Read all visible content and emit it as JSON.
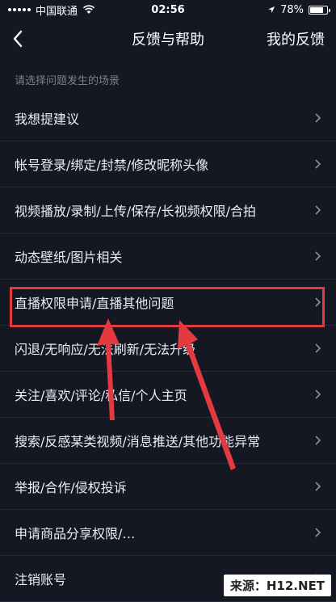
{
  "status_bar": {
    "carrier": "中国联通",
    "time": "02:56",
    "battery": "78%"
  },
  "nav": {
    "title": "反馈与帮助",
    "action": "我的反馈"
  },
  "section_hint": "请选择问题发生的场景",
  "items": [
    {
      "label": "我想提建议"
    },
    {
      "label": "帐号登录/绑定/封禁/修改昵称头像"
    },
    {
      "label": "视频播放/录制/上传/保存/长视频权限/合拍"
    },
    {
      "label": "动态壁纸/图片相关"
    },
    {
      "label": "直播权限申请/直播其他问题"
    },
    {
      "label": "闪退/无响应/无法刷新/无法升级"
    },
    {
      "label": "关注/喜欢/评论/私信/个人主页"
    },
    {
      "label": "搜索/反感某类视频/消息推送/其他功能异常"
    },
    {
      "label": "举报/合作/侵权投诉"
    },
    {
      "label": "申请商品分享权限/…"
    },
    {
      "label": "注销账号"
    }
  ],
  "watermark": "来源：H12.NET",
  "colors": {
    "background": "#151823",
    "highlight": "#e23a3f",
    "text": "#ececf2",
    "hint": "#7c7f8d"
  }
}
